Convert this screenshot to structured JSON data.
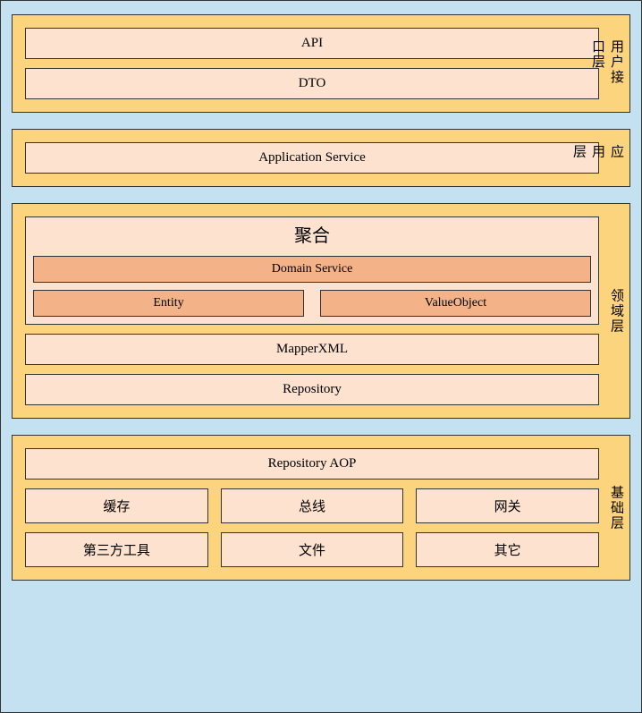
{
  "layers": {
    "ui": {
      "label": "用户接口层",
      "items": [
        "API",
        "DTO"
      ]
    },
    "app": {
      "label": "应用层",
      "items": [
        "Application Service"
      ]
    },
    "domain": {
      "label": "领域层",
      "aggregate": {
        "title": "聚合",
        "top": "Domain Service",
        "row": [
          "Entity",
          "ValueObject"
        ]
      },
      "items": [
        "MapperXML",
        "Repository"
      ]
    },
    "infra": {
      "label": "基础层",
      "top": "Repository AOP",
      "row1": [
        "缓存",
        "总线",
        "网关"
      ],
      "row2": [
        "第三方工具",
        "文件",
        "其它"
      ]
    }
  }
}
